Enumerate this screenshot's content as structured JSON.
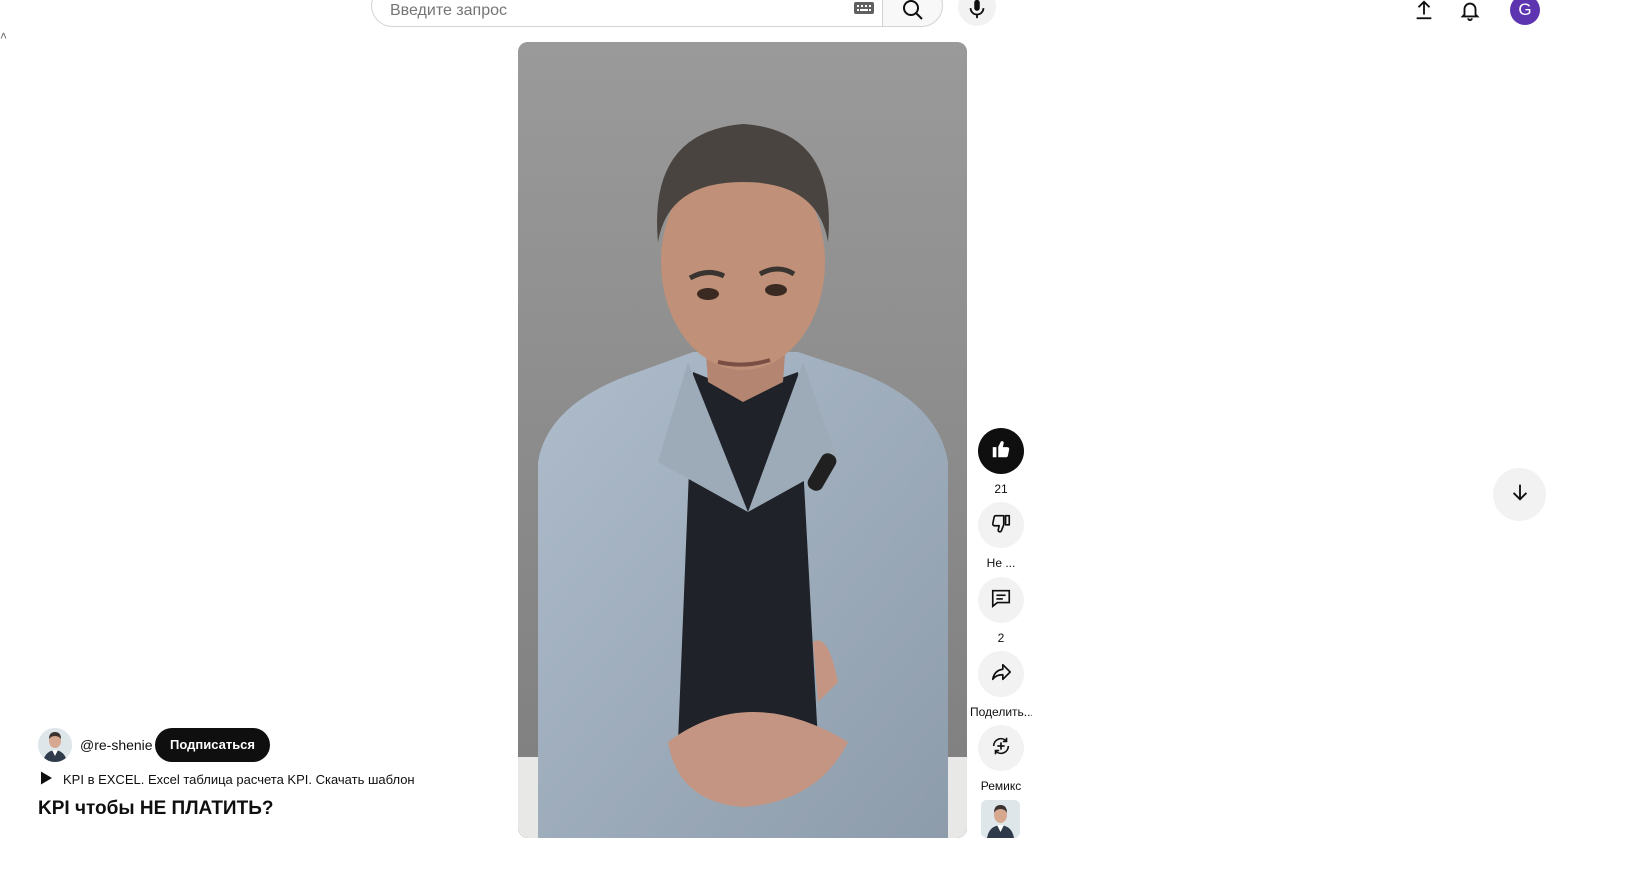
{
  "header": {
    "search": {
      "placeholder": "Введите запрос",
      "value": ""
    },
    "icons": [
      "keyboard-icon",
      "search-icon",
      "mic-icon",
      "upload-icon",
      "bell-icon"
    ],
    "avatar_letter": "G",
    "avatar_color": "#5e35b1"
  },
  "actions": {
    "like": {
      "label": "21",
      "icon": "thumbs-up-icon",
      "active": true
    },
    "dislike": {
      "label": "Не ...",
      "icon": "thumbs-down-icon"
    },
    "comments": {
      "label": "2",
      "icon": "comment-icon"
    },
    "share": {
      "label": "Поделить...",
      "icon": "share-icon"
    },
    "remix": {
      "label": "Ремикс",
      "icon": "remix-icon"
    }
  },
  "meta": {
    "channel_handle": "@re-shenie",
    "subscribe_label": "Подписаться",
    "linked_video": "KPI в EXCEL. Excel таблица расчета KPI. Скачать шаблон",
    "title": "KPI чтобы НЕ ПЛАТИТЬ?"
  },
  "navigation": {
    "next_icon": "arrow-down-icon"
  },
  "colors": {
    "accent": "#0f0f0f",
    "button_bg": "#f2f2f2",
    "background": "#ffffff"
  }
}
